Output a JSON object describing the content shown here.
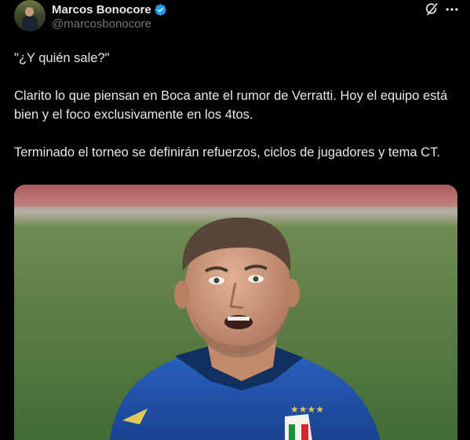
{
  "author": {
    "display_name": "Marcos Bonocore",
    "handle": "@marcosbonocore",
    "verified": true,
    "avatar_icon": "profile-avatar"
  },
  "actions": {
    "grok_icon": "grok-icon",
    "more_icon": "more-icon"
  },
  "tweet": {
    "paragraphs": [
      "\"¿Y quién sale?\"",
      "Clarito lo que piensan en Boca ante el rumor de Verratti. Hoy el equipo está bien y el foco exclusivamente en los 4tos.",
      "Terminado el torneo se definirán refuerzos, ciclos de jugadores y tema CT."
    ]
  },
  "media": {
    "icon": "player-photo",
    "colors": {
      "pitch": "#4a7a3a",
      "shirt": "#1d4ea8",
      "accent": "#1d9bf0"
    }
  },
  "colors": {
    "background": "#000000",
    "text": "#e7e9ea",
    "secondary_text": "#71767b",
    "verified": "#1d9bf0"
  }
}
